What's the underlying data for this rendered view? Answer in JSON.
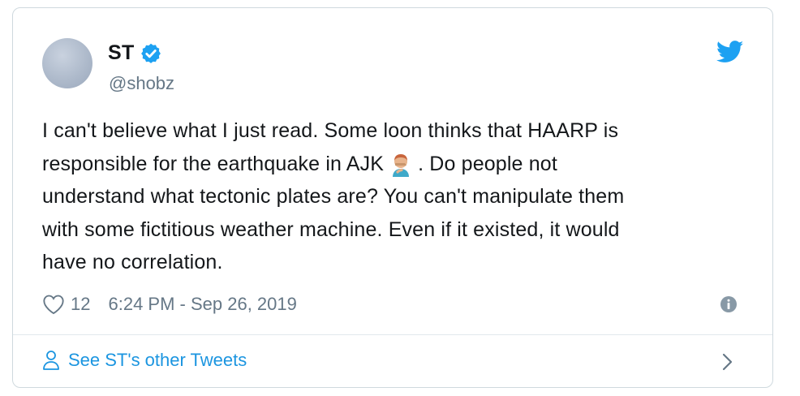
{
  "tweet": {
    "author": {
      "name": "ST",
      "handle": "@shobz",
      "verified": true
    },
    "text_lines": {
      "l1": "I can't believe what I just read. Some loon thinks that HAARP is",
      "l2a": "responsible for the earthquake in AJK",
      "l2b": ". Do people not",
      "l3": "understand what tectonic plates are? You can't manipulate them",
      "l4": "with some fictitious weather machine. Even if it existed, it would",
      "l5": "have no correlation."
    },
    "emoji": "facepalm-emoji",
    "likes": "12",
    "timestamp": "6:24 PM - Sep 26, 2019",
    "footer_link": "See ST's other Tweets"
  },
  "icons": {
    "verified": "verified-badge-icon",
    "brand": "twitter-bird-icon",
    "like": "heart-icon",
    "info": "info-icon",
    "profile": "person-icon",
    "chevron": "chevron-right-icon"
  },
  "colors": {
    "brand": "#1da1f2",
    "link": "#1b95e0",
    "muted": "#657786",
    "text": "#14171a",
    "border": "#cfd9de"
  }
}
